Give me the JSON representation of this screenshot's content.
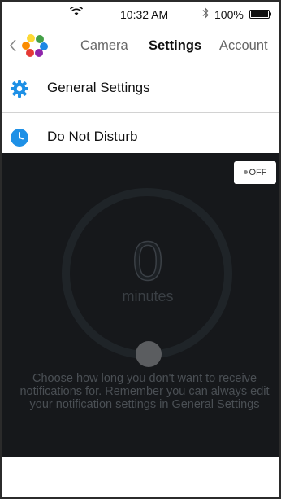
{
  "status_bar": {
    "time": "10:32 AM",
    "battery_percent": "100%",
    "battery_level": 1.0,
    "icons": [
      "wifi-icon",
      "bluetooth-icon",
      "battery-icon"
    ]
  },
  "nav": {
    "back_icon": "chevron-left-icon",
    "logo_icon": "app-logo-icon",
    "tabs": [
      {
        "label": "Camera",
        "active": false
      },
      {
        "label": "Settings",
        "active": true
      },
      {
        "label": "Account",
        "active": false
      }
    ]
  },
  "rows": {
    "general": {
      "label": "General Settings",
      "icon": "gear-icon"
    },
    "dnd": {
      "label": "Do Not Disturb",
      "icon": "clock-icon"
    }
  },
  "dnd_panel": {
    "toggle_label": "OFF",
    "minutes_value": "0",
    "minutes_label": "minutes",
    "helper_text": "Choose how long you don't want to receive notifications for. Remember you can always edit your notification settings in General Settings"
  },
  "colors": {
    "accent_blue": "#1e90e6",
    "panel_background": "#16181b",
    "logo_colors": [
      "#e53935",
      "#fb8c00",
      "#fdd835",
      "#43a047",
      "#1e88e5",
      "#8e24aa"
    ]
  }
}
